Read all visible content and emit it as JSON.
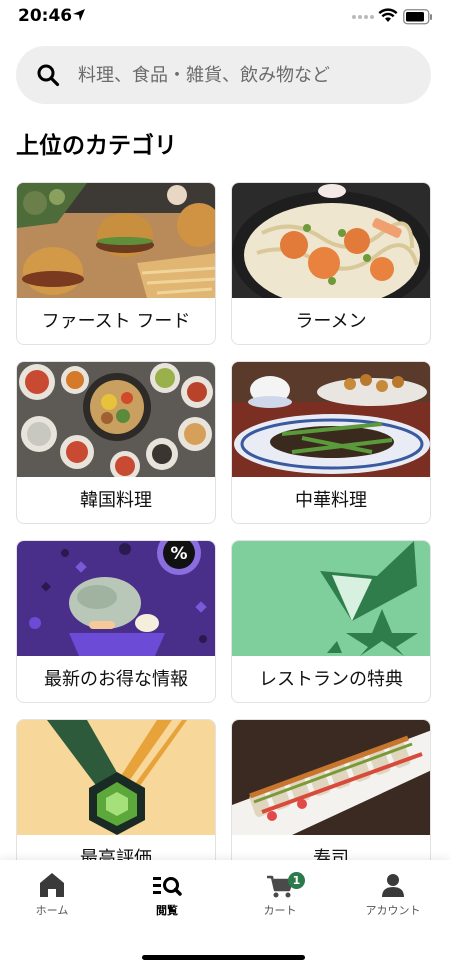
{
  "status_bar": {
    "time": "20:46"
  },
  "search": {
    "placeholder": "料理、食品・雑貨、飲み物など"
  },
  "section": {
    "title": "上位のカテゴリ"
  },
  "categories": [
    {
      "label": "ファースト フード"
    },
    {
      "label": "ラーメン"
    },
    {
      "label": "韓国料理"
    },
    {
      "label": "中華料理"
    },
    {
      "label": "最新のお得な情報"
    },
    {
      "label": "レストランの特典"
    },
    {
      "label": "最高評価"
    },
    {
      "label": "寿司"
    }
  ],
  "bottom_nav": {
    "items": [
      {
        "label": "ホーム",
        "icon": "home-icon"
      },
      {
        "label": "閲覧",
        "icon": "browse-icon"
      },
      {
        "label": "カート",
        "icon": "cart-icon"
      },
      {
        "label": "アカウント",
        "icon": "account-icon"
      }
    ],
    "cart_badge": "1",
    "active": "閲覧"
  },
  "colors": {
    "accent": "#2c7a4b",
    "deals_bg": "#4a2f8a",
    "perks_bg": "#7fcf9c",
    "top_rated_bg": "#f7d79a"
  }
}
